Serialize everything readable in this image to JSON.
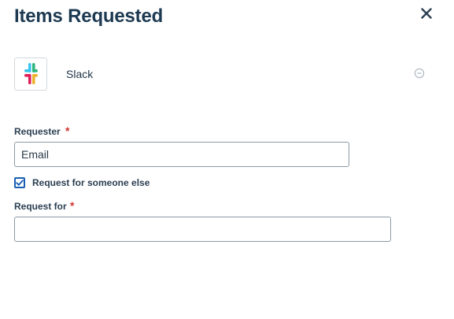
{
  "header": {
    "title": "Items Requested"
  },
  "item": {
    "app_name": "Slack"
  },
  "requester": {
    "label": "Requester",
    "required_mark": "*",
    "value": "Email"
  },
  "someone_else": {
    "label": "Request for someone else",
    "checked": true
  },
  "request_for": {
    "label": "Request for",
    "required_mark": "*",
    "value": ""
  },
  "colors": {
    "title": "#1d3a52",
    "required": "#d0332f",
    "checkbox_accent": "#1a5fb4",
    "slack_cyan": "#36c5f0",
    "slack_green": "#2eb67d",
    "slack_yellow": "#ecb22e",
    "slack_red": "#e01e5a"
  }
}
